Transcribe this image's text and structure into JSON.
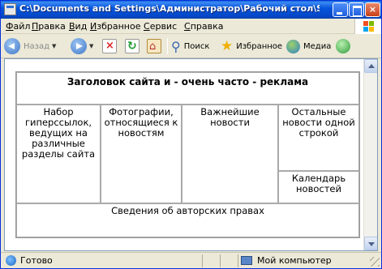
{
  "window": {
    "title": "C:\\Documents and Settings\\Администратор\\Рабочий стол\\Samples\\Macromedi...",
    "min_label": "",
    "max_label": "",
    "close_label": "×"
  },
  "menu": [
    "Файл",
    "Правка",
    "Вид",
    "Избранное",
    "Сервис",
    "Справка"
  ],
  "toolbar": {
    "back_label": "Назад",
    "search_label": "Поиск",
    "favorites_label": "Избранное",
    "media_label": "Медиа"
  },
  "page": {
    "header": "Заголовок сайта и - очень часто - реклама",
    "nav": "Набор гиперссылок, ведущих на различные разделы сайта",
    "photos": "Фотографии, относящиеся к новостям",
    "news": "Важнейшие новости",
    "other_news": "Остальные новости одной строкой",
    "calendar": "Календарь новостей",
    "footer": "Сведения об авторских правах"
  },
  "status": {
    "left": "Готово",
    "right": "Мой компьютер"
  },
  "colors": {
    "titlebar": "#0855dd",
    "chrome": "#ece9d8",
    "page_bg": "#ffffff"
  }
}
